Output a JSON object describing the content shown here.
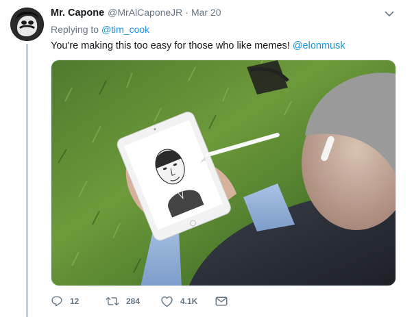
{
  "tweet": {
    "author_name": "Mr. Capone",
    "handle": "@MrAlCaponeJR",
    "separator": "·",
    "date": "Mar 20",
    "reply_prefix": "Replying to",
    "reply_to": "@tim_cook",
    "text": "You're making this too easy for those who like memes!",
    "text_mention": "@elonmusk"
  },
  "actions": {
    "reply_count": "12",
    "retweet_count": "284",
    "like_count": "4.1K"
  },
  "colors": {
    "link": "#1b95e0",
    "secondary_text": "#657786",
    "thread_line": "#c4cfd6"
  },
  "icons": {
    "more": "chevron-down-icon",
    "reply": "reply-icon",
    "retweet": "retweet-icon",
    "like": "heart-icon",
    "dm": "envelope-icon"
  }
}
